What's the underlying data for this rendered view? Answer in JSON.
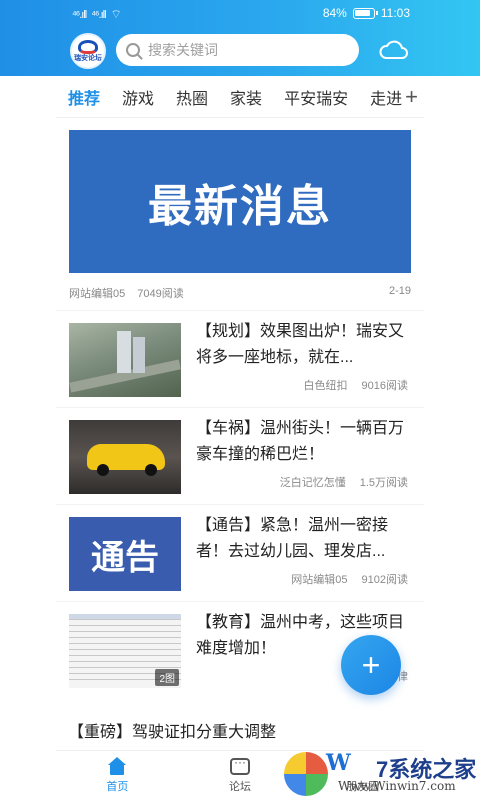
{
  "status_bar": {
    "signal_left": "⁴⁶.ıll",
    "signal_right": "⁴⁶.ıll",
    "battery": "84%",
    "time": "11:03"
  },
  "header": {
    "logo_text": "瑞安论坛",
    "search_placeholder": "搜索关键词",
    "accent_color": "#2aa7ee"
  },
  "tabs": {
    "items": [
      "推荐",
      "游戏",
      "热圈",
      "家装",
      "平安瑞安",
      "走进"
    ],
    "active": "推荐",
    "add_label": "+"
  },
  "banner": {
    "text": "最新消息",
    "author": "网站编辑05",
    "reads": "7049阅读",
    "date": "2-19"
  },
  "news": [
    {
      "title": "【规划】效果图出炉！瑞安又将多一座地标，就在...",
      "author": "白色纽扣",
      "reads": "9016阅读"
    },
    {
      "title": "【车祸】温州街头！一辆百万豪车撞的稀巴烂！",
      "author": "泛白记忆怎懂",
      "reads": "1.5万阅读"
    },
    {
      "title": "【通告】紧急！温州一密接者！去过幼儿园、理发店...",
      "author": "网站编辑05",
      "reads": "9102阅读",
      "thumb_text": "通告"
    },
    {
      "title": "【教育】温州中考，这些项目难度增加！",
      "author": "旧年旋律",
      "reads": "",
      "badge": "2图"
    }
  ],
  "fab_label": "+",
  "headline": "【重磅】驾驶证扣分重大调整",
  "bottom_nav": {
    "items": [
      {
        "label": "首页",
        "active": true
      },
      {
        "label": "论坛",
        "active": false
      },
      {
        "label": "朋友圈",
        "active": false
      }
    ]
  },
  "watermark": {
    "brand": "W",
    "system_text": "7系统之家",
    "url": "Www.Winwin7.com"
  }
}
